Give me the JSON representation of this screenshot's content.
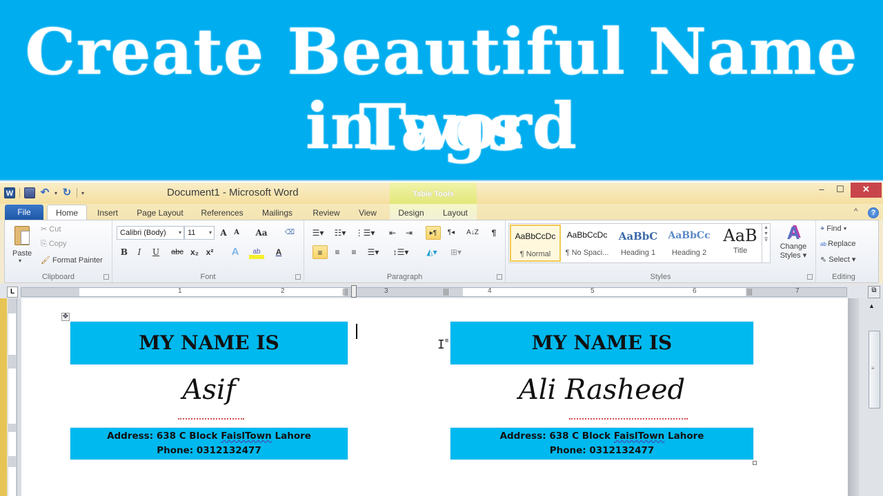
{
  "banner": {
    "line1": "Create Beautiful  Name Tags",
    "line2": "in word",
    "bg_color": "#00adef"
  },
  "window": {
    "title": "Document1  -  Microsoft Word",
    "contextual_tab_group": "Table Tools",
    "controls": {
      "minimize": "–",
      "maximize": "☐",
      "close": "✕"
    },
    "help": "?",
    "collapse_ribbon": "^"
  },
  "qat": {
    "app_icon": "W",
    "save": "save-icon",
    "undo": "↶",
    "redo": "↻",
    "customize": "▾"
  },
  "tabs": [
    {
      "label": "File"
    },
    {
      "label": "Home"
    },
    {
      "label": "Insert"
    },
    {
      "label": "Page Layout"
    },
    {
      "label": "References"
    },
    {
      "label": "Mailings"
    },
    {
      "label": "Review"
    },
    {
      "label": "View"
    },
    {
      "label": "Design"
    },
    {
      "label": "Layout"
    }
  ],
  "ribbon": {
    "clipboard": {
      "label": "Clipboard",
      "paste": "Paste",
      "cut": "Cut",
      "copy": "Copy",
      "format_painter": "Format Painter"
    },
    "font": {
      "label": "Font",
      "font_name": "Calibri (Body)",
      "font_size": "11",
      "grow": "A",
      "shrink": "A",
      "change_case": "Aa",
      "bold": "B",
      "italic": "I",
      "underline": "U",
      "strikethrough": "abc",
      "subscript": "x₂",
      "superscript": "x²",
      "text_effects": "A",
      "highlight": "ab",
      "font_color": "A"
    },
    "paragraph": {
      "label": "Paragraph",
      "show_marks": "¶",
      "sort": "A↓Z"
    },
    "styles": {
      "label": "Styles",
      "items": [
        {
          "preview": "AaBbCcDc",
          "label": "¶ Normal",
          "selected": true
        },
        {
          "preview": "AaBbCcDc",
          "label": "¶ No Spaci...",
          "selected": false
        },
        {
          "preview": "AaBbC",
          "label": "Heading 1",
          "selected": false
        },
        {
          "preview": "AaBbCc",
          "label": "Heading 2",
          "selected": false
        },
        {
          "preview": "AaB",
          "label": "Title",
          "selected": false
        }
      ],
      "change_styles": "Change Styles ▾"
    },
    "editing": {
      "label": "Editing",
      "find": "Find ▾",
      "replace": "Replace",
      "select": "Select ▾"
    }
  },
  "ruler": {
    "tab_selector": "L",
    "numbers": [
      "1",
      "1",
      "2",
      "3",
      "4",
      "5",
      "6",
      "7"
    ]
  },
  "document": {
    "tags": [
      {
        "header": "MY NAME IS",
        "name": "Asif",
        "address_prefix": "Address: 638 C Block ",
        "address_misspelled": "FaislTown",
        "address_suffix": " Lahore",
        "phone": "Phone: 0312132477"
      },
      {
        "header": "MY NAME IS",
        "name": "Ali Rasheed",
        "address_prefix": "Address: 638 C Block ",
        "address_misspelled": "FaislTown",
        "address_suffix": " Lahore",
        "phone": "Phone: 0312132477"
      }
    ],
    "tag_color": "#00b9ef"
  }
}
